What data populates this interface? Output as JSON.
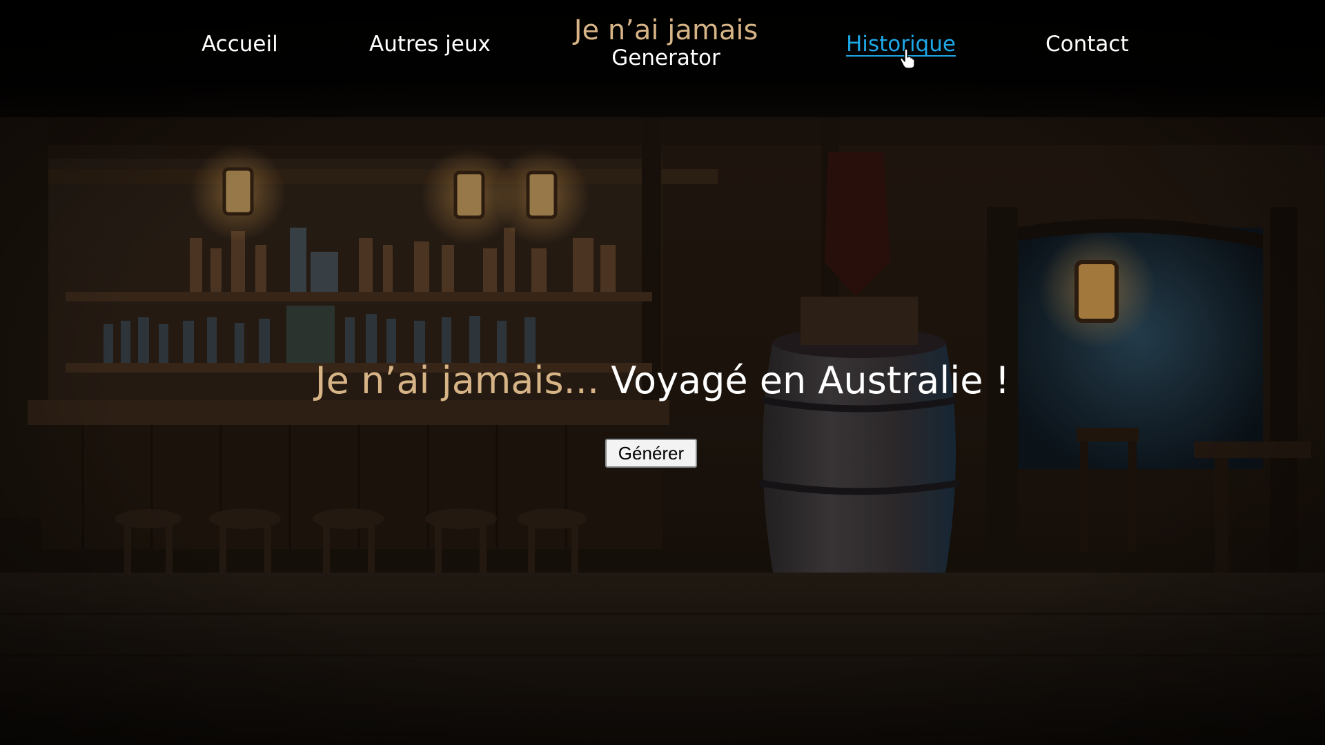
{
  "nav": {
    "items": [
      {
        "label": "Accueil"
      },
      {
        "label": "Autres jeux"
      },
      {
        "label": "Historique",
        "active": true
      },
      {
        "label": "Contact"
      }
    ],
    "brand": {
      "title": "Je n’ai jamais",
      "subtitle": "Generator"
    }
  },
  "main": {
    "prefix": "Je n’ai jamais...",
    "statement": "Voyagé en Australie !",
    "generate_label": "Générer"
  },
  "colors": {
    "accent_gold": "#d7b486",
    "active_link": "#1ea7e6",
    "text": "#ffffff"
  }
}
